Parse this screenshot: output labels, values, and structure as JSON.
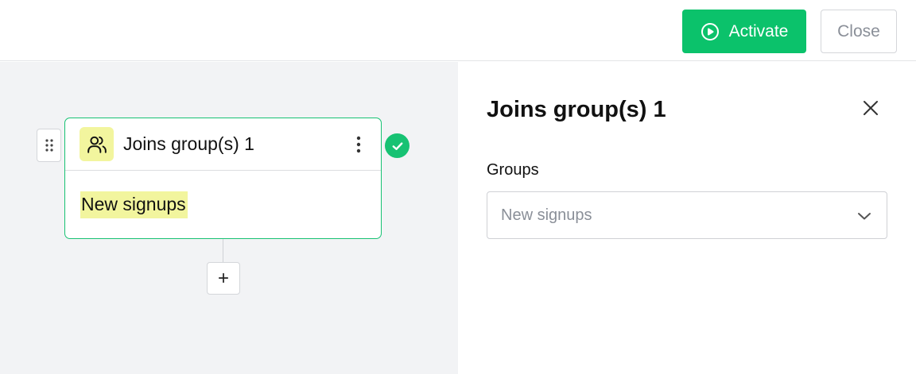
{
  "toolbar": {
    "activate_label": "Activate",
    "close_label": "Close",
    "activate_icon": "play-circle-icon",
    "accent_color": "#0bc26b"
  },
  "node": {
    "title": "Joins group(s) 1",
    "tag": "New signups",
    "icon": "users-icon",
    "status_icon": "check-circle-icon",
    "menu_icon": "more-vertical-icon",
    "drag_icon": "drag-handle-icon"
  },
  "add_step": {
    "label": "+"
  },
  "panel": {
    "title": "Joins group(s) 1",
    "close_icon": "close-icon",
    "field_label": "Groups",
    "select_value": "New signups",
    "select_icon": "chevron-down-icon"
  }
}
